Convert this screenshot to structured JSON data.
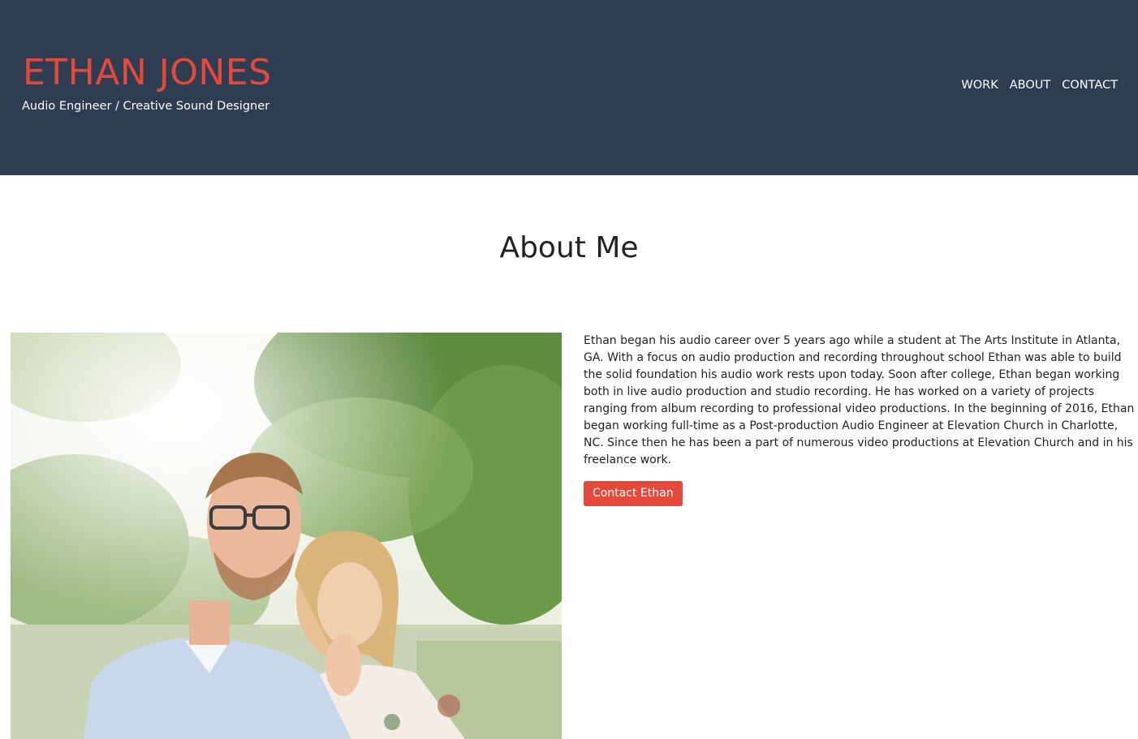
{
  "header": {
    "brand_name": "ETHAN JONES",
    "tagline": "Audio Engineer / Creative Sound Designer",
    "nav": [
      {
        "label": "WORK"
      },
      {
        "label": "ABOUT"
      },
      {
        "label": "CONTACT"
      }
    ]
  },
  "about": {
    "title": "About Me",
    "bio": "Ethan began his audio career over 5 years ago while a student at The Arts Institute in Atlanta, GA. With a focus on audio production and recording throughout school Ethan was able to build the solid foundation his audio work rests upon today. Soon after college, Ethan began working both in live audio production and studio recording. He has worked on a variety of projects ranging from album recording to professional video productions. In the beginning of 2016, Ethan began working full-time as a Post-production Audio Engineer at Elevation Church in Charlotte, NC. Since then he has been a part of numerous video productions at Elevation Church and in his freelance work.",
    "contact_button": "Contact Ethan"
  },
  "colors": {
    "header_bg": "#2e3d51",
    "accent": "#e34a3c",
    "text": "#222222"
  }
}
